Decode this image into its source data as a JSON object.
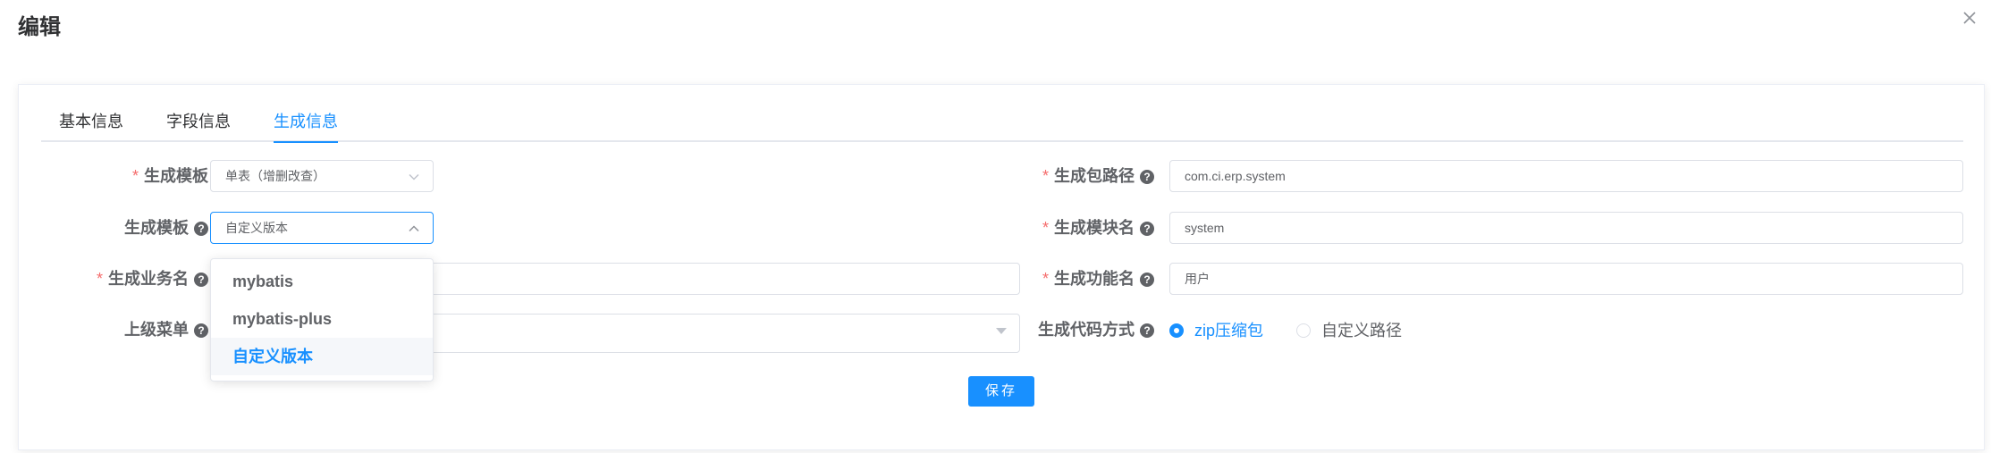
{
  "dialog": {
    "title": "编辑"
  },
  "tabs": [
    {
      "label": "基本信息"
    },
    {
      "label": "字段信息"
    },
    {
      "label": "生成信息"
    }
  ],
  "form": {
    "tpl_category": {
      "label": "生成模板",
      "required": true,
      "value": "单表（增删改查）"
    },
    "tpl_version": {
      "label": "生成模板",
      "value": "自定义版本"
    },
    "business_name": {
      "label": "生成业务名",
      "required": true,
      "value": ""
    },
    "parent_menu": {
      "label": "上级菜单",
      "value": ""
    },
    "package_name": {
      "label": "生成包路径",
      "required": true,
      "value": "com.ci.erp.system"
    },
    "module_name": {
      "label": "生成模块名",
      "required": true,
      "value": "system"
    },
    "function_name": {
      "label": "生成功能名",
      "required": true,
      "value": "用户"
    },
    "gen_type": {
      "label": "生成代码方式",
      "options": [
        {
          "label": "zip压缩包",
          "checked": true
        },
        {
          "label": "自定义路径",
          "checked": false
        }
      ]
    }
  },
  "dropdown": {
    "options": [
      {
        "label": "mybatis"
      },
      {
        "label": "mybatis-plus"
      },
      {
        "label": "自定义版本"
      }
    ],
    "selected": "自定义版本"
  },
  "save_label": "保存",
  "required_mark": "*",
  "help_mark": "?",
  "accent_color": "#1890ff",
  "icons": {
    "close": "close-icon",
    "help": "question-circle-icon",
    "select": "chevron-icon"
  }
}
